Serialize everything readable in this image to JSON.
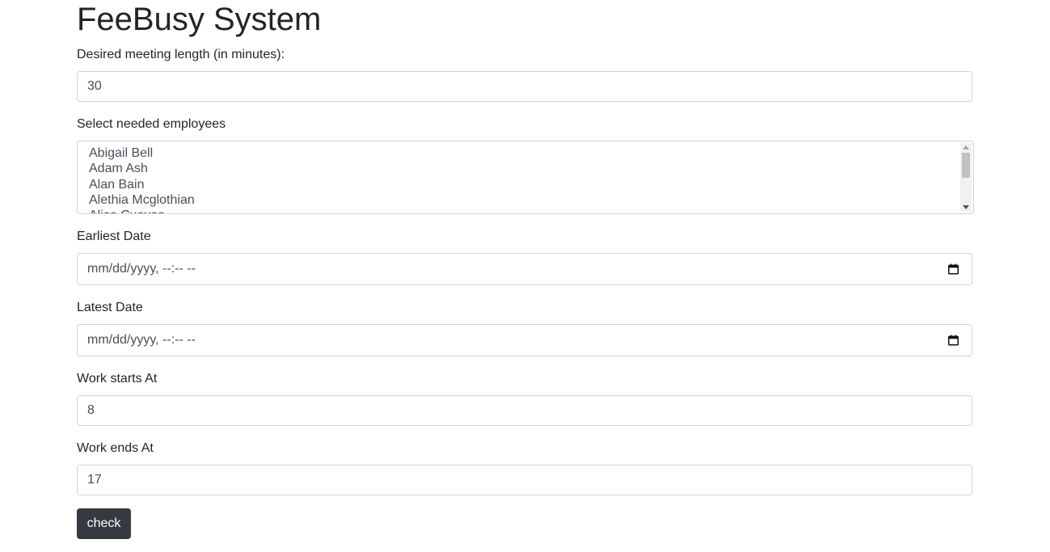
{
  "page": {
    "title": "FeeBusy System"
  },
  "form": {
    "meeting_length": {
      "label": "Desired meeting length (in minutes):",
      "value": "30"
    },
    "employees": {
      "label": "Select needed employees",
      "options": [
        "Abigail Bell",
        "Adam Ash",
        "Alan Bain",
        "Alethia Mcglothian",
        "Alice Cuevas"
      ]
    },
    "earliest_date": {
      "label": "Earliest Date",
      "placeholder": "mm/dd/yyyy, --:-- --"
    },
    "latest_date": {
      "label": "Latest Date",
      "placeholder": "mm/dd/yyyy, --:-- --"
    },
    "work_start": {
      "label": "Work starts At",
      "value": "8"
    },
    "work_end": {
      "label": "Work ends At",
      "value": "17"
    },
    "submit_label": "check"
  },
  "icons": {
    "date_picker": "calendar-icon"
  }
}
